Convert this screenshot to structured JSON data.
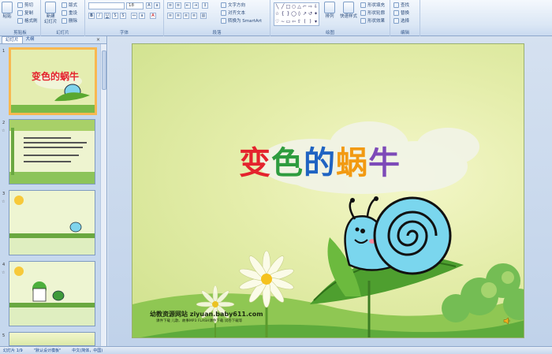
{
  "ribbon": {
    "clipboard": {
      "paste": "粘贴",
      "cut": "剪切",
      "copy": "复制",
      "format_painter": "格式刷",
      "label": "剪贴板"
    },
    "slides": {
      "new_slide": "新建\n幻灯片",
      "layout": "版式",
      "reset": "重设",
      "delete": "删除",
      "label": "幻灯片"
    },
    "font": {
      "font_size": "18",
      "label": "字体"
    },
    "paragraph": {
      "text_direction": "文字方向",
      "align_text": "对齐文本",
      "smartart": "转换为 SmartArt",
      "label": "段落"
    },
    "drawing": {
      "arrange": "排列",
      "quick_styles": "快速样式",
      "shape_fill": "形状填充",
      "shape_outline": "形状轮廓",
      "shape_effects": "形状效果",
      "label": "绘图"
    },
    "editing": {
      "find": "查找",
      "replace": "替换",
      "select": "选择",
      "label": "编辑"
    }
  },
  "left_pane": {
    "tab_slides": "幻灯片",
    "tab_outline": "大纲",
    "close": "×",
    "thumbnails": [
      {
        "num": "1",
        "title": "变色的蜗牛",
        "selected": true
      },
      {
        "num": "2",
        "selected": false
      },
      {
        "num": "3",
        "selected": false
      },
      {
        "num": "4",
        "selected": false
      },
      {
        "num": "5",
        "selected": false
      }
    ]
  },
  "slide": {
    "title_chars": [
      "变",
      "色",
      "的",
      "蜗",
      "牛"
    ],
    "site_line": "幼教资源网站  ziyuan.baby611.com",
    "site_sub": "课件下载   儿歌、故事MP3   FLASH课件下载   试卷下载等"
  },
  "status": {
    "slide_index": "幻灯片 1/9",
    "theme": "\"默认设计模板\"",
    "language": "中文(简体，中国)"
  },
  "colors": {
    "title_1": "#e4232d",
    "title_2": "#2e9c3e",
    "title_3": "#1f63c2",
    "title_4": "#f29a12",
    "title_5": "#7d4ab8",
    "selected_thumb_border": "#f8b850"
  }
}
